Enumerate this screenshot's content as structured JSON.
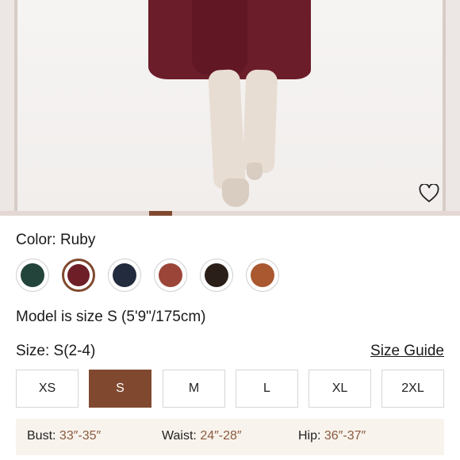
{
  "gallery": {
    "favorite_icon": "heart-outline-icon",
    "progress": 0.05
  },
  "color": {
    "label": "Color: Ruby",
    "swatches": [
      {
        "name": "green",
        "hex": "#23443a"
      },
      {
        "name": "ruby",
        "hex": "#6e1e27",
        "selected": true
      },
      {
        "name": "navy",
        "hex": "#232b3e"
      },
      {
        "name": "rust",
        "hex": "#9b4538"
      },
      {
        "name": "brown",
        "hex": "#2b1f1a"
      },
      {
        "name": "cognac",
        "hex": "#a9582f"
      }
    ]
  },
  "model_text": "Model is size S (5'9\"/175cm)",
  "size": {
    "label": "Size: S(2-4)",
    "guide_link": "Size Guide",
    "options": [
      "XS",
      "S",
      "M",
      "L",
      "XL",
      "2XL"
    ],
    "selected": "S"
  },
  "measurements": {
    "bust_label": "Bust:",
    "bust_value": "33″-35″",
    "waist_label": "Waist:",
    "waist_value": "24″-28″",
    "hip_label": "Hip:",
    "hip_value": "36″-37″"
  },
  "colors": {
    "accent": "#80492f",
    "measure_bg": "#f8f3ed"
  }
}
